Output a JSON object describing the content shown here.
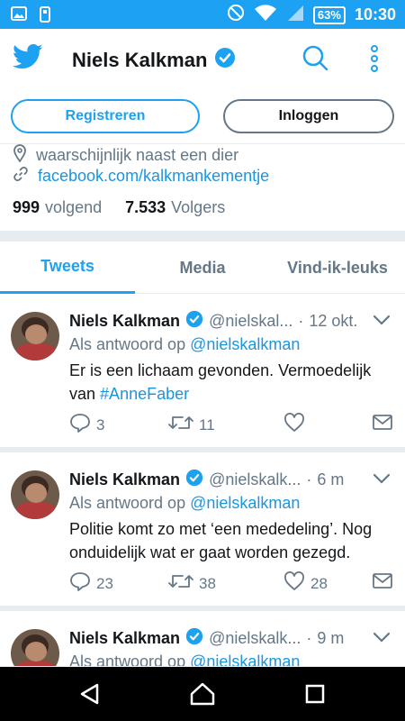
{
  "status_bar": {
    "time": "10:30",
    "battery": "63%",
    "icons": [
      "image-icon",
      "phone-icon",
      "do-not-disturb-icon",
      "wifi-icon",
      "signal-icon",
      "battery-icon"
    ]
  },
  "header": {
    "title": "Niels Kalkman",
    "verified": true,
    "icons": [
      "twitter-bird-icon",
      "verified-icon",
      "search-icon",
      "more-vertical-icon"
    ]
  },
  "actions": {
    "register_label": "Registreren",
    "login_label": "Inloggen"
  },
  "profile": {
    "location": "waarschijnlijk naast een dier",
    "website": "facebook.com/kalkmankementje",
    "following_count": "999",
    "following_label": "volgend",
    "followers_count": "7.533",
    "followers_label": "Volgers"
  },
  "tabs": [
    {
      "label": "Tweets",
      "active": true
    },
    {
      "label": "Media",
      "active": false
    },
    {
      "label": "Vind-ik-leuks",
      "active": false
    }
  ],
  "tweets": [
    {
      "name": "Niels Kalkman",
      "handle": "@nielskal...",
      "time": "12 okt.",
      "reply_prefix": "Als antwoord op",
      "reply_to": "@nielskalkman",
      "text_line1": "Er is een lichaam gevonden. Vermoedelijk",
      "text_line2_prefix": "van",
      "hashtag": "#AnneFaber",
      "replies": "3",
      "retweets": "11",
      "likes": ""
    },
    {
      "name": "Niels Kalkman",
      "handle": "@nielskalk...",
      "time": "6 m",
      "reply_prefix": "Als antwoord op",
      "reply_to": "@nielskalkman",
      "text_line1": "Politie komt zo met ‘een mededeling’. Nog",
      "text_line2": "onduidelijk wat er gaat worden gezegd.",
      "replies": "23",
      "retweets": "38",
      "likes": "28"
    },
    {
      "name": "Niels Kalkman",
      "handle": "@nielskalk...",
      "time": "9 m",
      "reply_prefix": "Als antwoord op",
      "reply_to": "@nielskalkman"
    }
  ],
  "colors": {
    "brand": "#1da1f2",
    "link": "#1b95e0",
    "muted": "#657786",
    "text": "#14171a"
  }
}
